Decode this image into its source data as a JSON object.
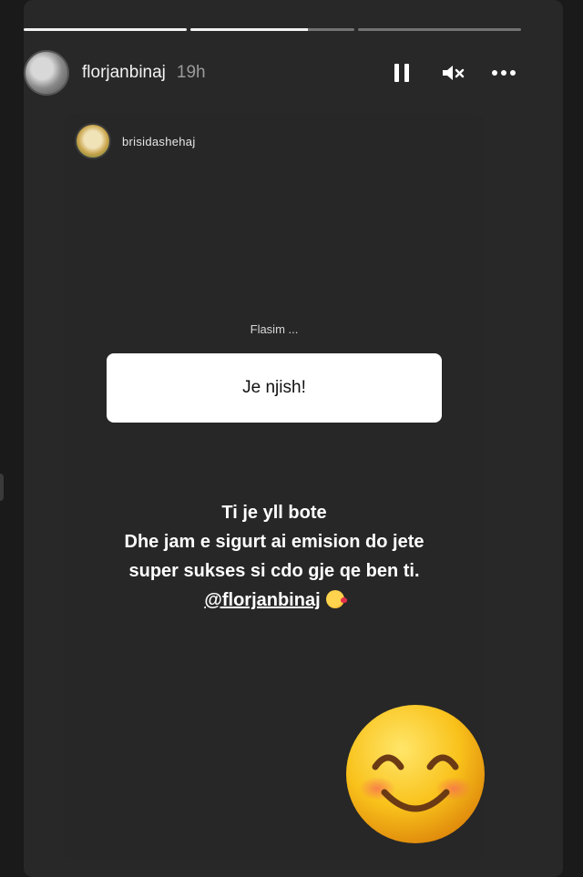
{
  "story": {
    "progress": [
      1.0,
      0.72,
      0.0
    ],
    "author": {
      "username": "florjanbinaj",
      "time": "19h"
    },
    "controls": {
      "pause_icon": "pause-icon",
      "mute_icon": "muted-speaker-icon",
      "more_icon": "more-horizontal-icon"
    }
  },
  "mention": {
    "username": "brisidashehaj"
  },
  "question": {
    "label": "Flasim ...",
    "answer": "Je njish!"
  },
  "caption": {
    "line1": "Ti je yll bote",
    "line2": "Dhe jam e sigurt ai emision do jete",
    "line3": "super sukses si cdo gje qe ben ti.",
    "handle": "@florjanbinaj"
  },
  "colors": {
    "background": "#1a1a1a",
    "story_bg": "#282828",
    "text": "#ffffff",
    "muted": "#9a9a9a"
  }
}
